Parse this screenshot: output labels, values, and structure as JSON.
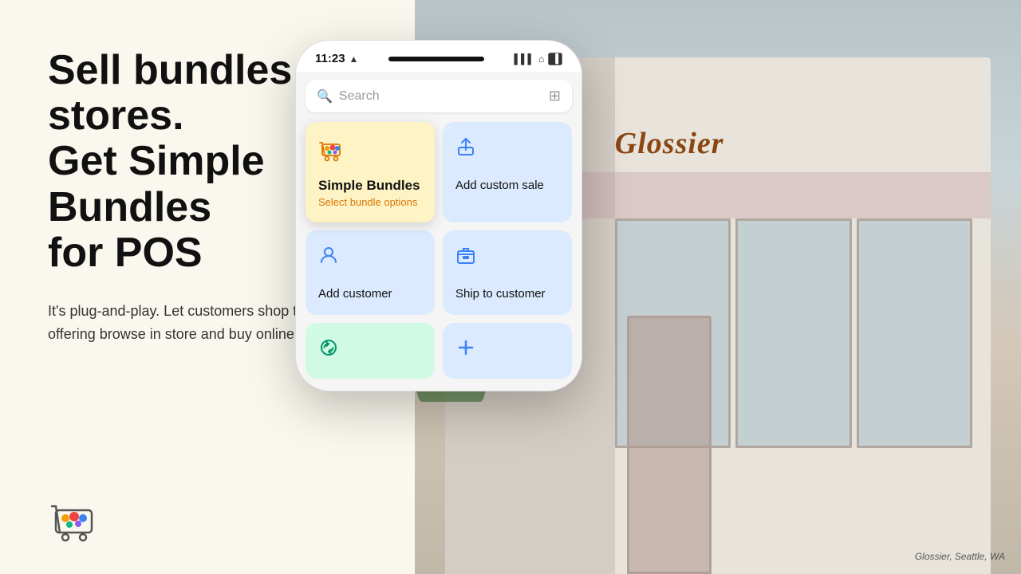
{
  "left": {
    "heading_line1": "Sell bundles in-stores.",
    "heading_line2": "Get Simple Bundles",
    "heading_line3": "for POS",
    "subtext": "It's plug-and-play. Let customers shop their way by offering browse in store and buy online."
  },
  "phone": {
    "time": "11:23",
    "search_placeholder": "Search",
    "tiles": {
      "bundles_title": "Simple Bundles",
      "bundles_sub": "Select bundle options",
      "add_custom_sale": "Add custom sale",
      "add_customer": "Add customer",
      "ship_to_customer": "Ship to customer"
    }
  },
  "photo_credit": "Glossier, Seattle, WA"
}
